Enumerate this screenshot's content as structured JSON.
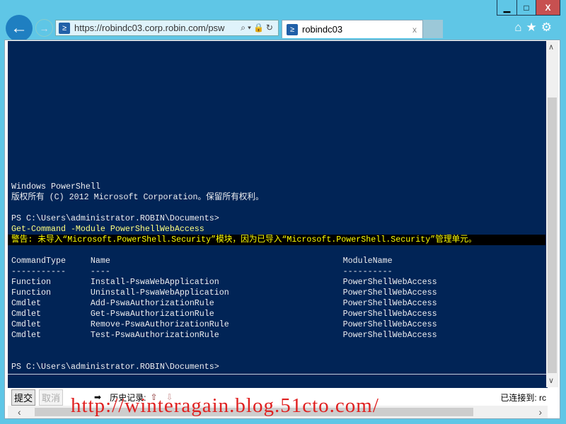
{
  "window": {
    "minimize": "▁",
    "maximize": "□",
    "close": "X"
  },
  "nav": {
    "back_icon": "arrow-left",
    "forward_icon": "arrow-right"
  },
  "address": {
    "url": "https://robindc03.corp.robin.com/psw",
    "tools": "⌕▾🔒↻"
  },
  "tab": {
    "title": "robindc03",
    "close": "x"
  },
  "toolbar_icons": "⌂★⚙",
  "console": {
    "colors": {
      "background": "#012456",
      "text": "#eeedf0",
      "command": "#ffff80",
      "warning": "#ffff00"
    },
    "lines": [
      {
        "t": "Windows PowerShell",
        "k": ""
      },
      {
        "t": "版权所有 (C) 2012 Microsoft Corporation。保留所有权利。",
        "k": ""
      },
      {
        "t": "",
        "k": ""
      },
      {
        "t": "PS C:\\Users\\administrator.ROBIN\\Documents>",
        "k": ""
      },
      {
        "t": "Get-Command -Module PowerShellWebAccess",
        "k": "cmd"
      },
      {
        "t": "警告: 未导入“Microsoft.PowerShell.Security”模块，因为已导入“Microsoft.PowerShell.Security”管理单元。",
        "k": "warn"
      },
      {
        "t": "",
        "k": ""
      },
      {
        "t": "CommandType     Name                                               ModuleName",
        "k": ""
      },
      {
        "t": "-----------     ----                                               ----------",
        "k": ""
      },
      {
        "t": "Function        Install-PswaWebApplication                         PowerShellWebAccess",
        "k": ""
      },
      {
        "t": "Function        Uninstall-PswaWebApplication                       PowerShellWebAccess",
        "k": ""
      },
      {
        "t": "Cmdlet          Add-PswaAuthorizationRule                          PowerShellWebAccess",
        "k": ""
      },
      {
        "t": "Cmdlet          Get-PswaAuthorizationRule                          PowerShellWebAccess",
        "k": ""
      },
      {
        "t": "Cmdlet          Remove-PswaAuthorizationRule                       PowerShellWebAccess",
        "k": ""
      },
      {
        "t": "Cmdlet          Test-PswaAuthorizationRule                         PowerShellWebAccess",
        "k": ""
      },
      {
        "t": "",
        "k": ""
      },
      {
        "t": "",
        "k": ""
      },
      {
        "t": "PS C:\\Users\\administrator.ROBIN\\Documents>",
        "k": ""
      }
    ]
  },
  "bottom": {
    "submit": "提交",
    "cancel": "取消",
    "history_label": "历史记录:",
    "connected": "已连接到: rc"
  },
  "watermark": "http://winteragain.blog.51cto.com/"
}
